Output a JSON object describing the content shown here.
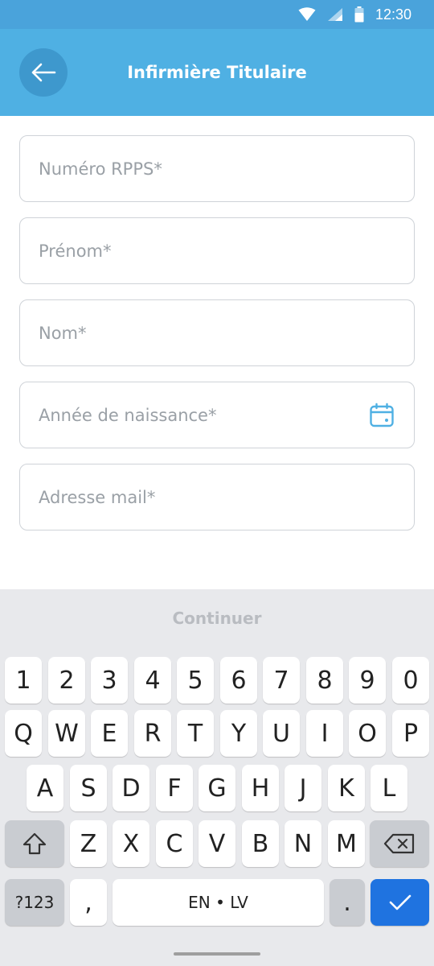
{
  "status_bar": {
    "time": "12:30",
    "icons": [
      "wifi-icon",
      "signal-icon",
      "battery-icon"
    ]
  },
  "app_bar": {
    "title": "Infirmière Titulaire",
    "back_icon": "arrow-left-icon"
  },
  "form": {
    "fields": [
      {
        "name": "rpps-number-field",
        "placeholder": "Numéro RPPS*",
        "value": ""
      },
      {
        "name": "first-name-field",
        "placeholder": "Prénom*",
        "value": ""
      },
      {
        "name": "last-name-field",
        "placeholder": "Nom*",
        "value": ""
      },
      {
        "name": "birth-year-field",
        "placeholder": "Année de naissance*",
        "value": "",
        "icon": "calendar-icon"
      },
      {
        "name": "email-field",
        "placeholder": "Adresse mail*",
        "value": ""
      }
    ]
  },
  "continue": {
    "label": "Continuer"
  },
  "keyboard": {
    "numbers": [
      "1",
      "2",
      "3",
      "4",
      "5",
      "6",
      "7",
      "8",
      "9",
      "0"
    ],
    "row1": [
      "Q",
      "W",
      "E",
      "R",
      "T",
      "Y",
      "U",
      "I",
      "O",
      "P"
    ],
    "row2": [
      "A",
      "S",
      "D",
      "F",
      "G",
      "H",
      "J",
      "K",
      "L"
    ],
    "row3": [
      "Z",
      "X",
      "C",
      "V",
      "B",
      "N",
      "M"
    ],
    "symbols_label": "?123",
    "comma": ",",
    "space_label": "EN • LV",
    "period": "."
  },
  "colors": {
    "primary": "#4fb0e3",
    "back_button": "#3e98cd",
    "enter_key": "#1f73e0",
    "keyboard_bg": "#e8e9ec"
  }
}
